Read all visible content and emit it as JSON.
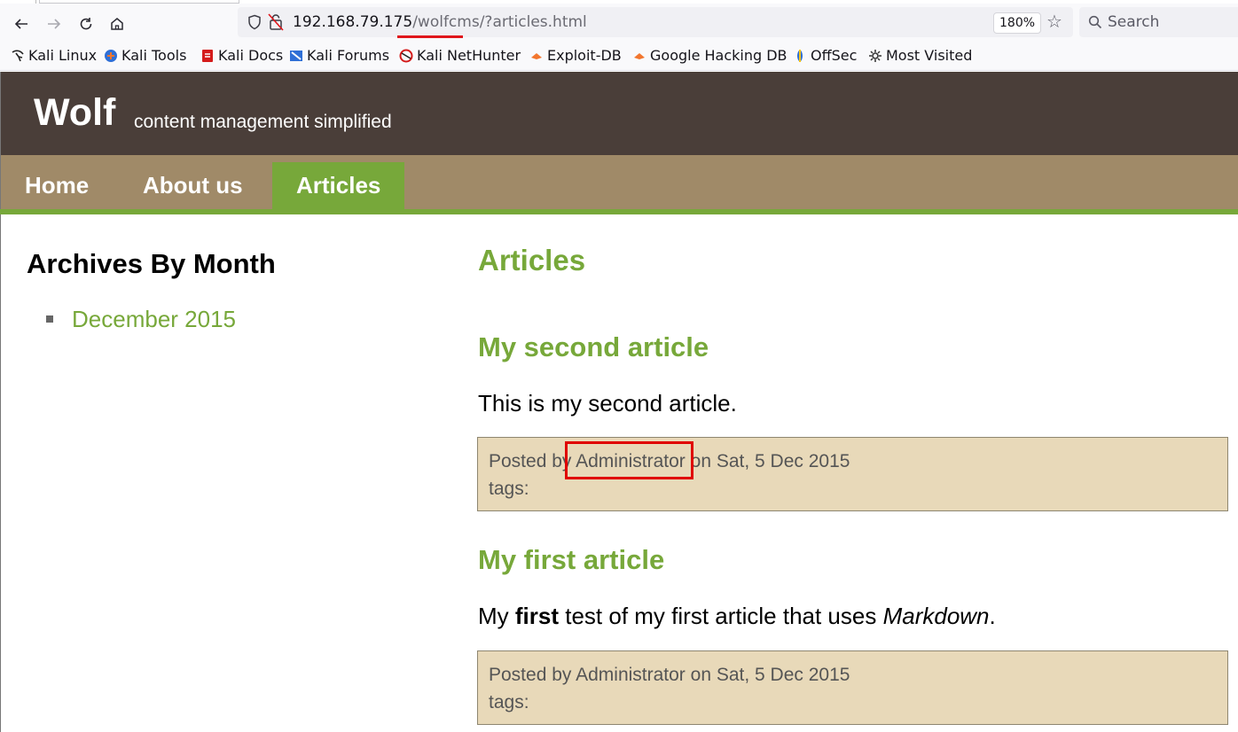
{
  "browser": {
    "url_host": "192.168.79.175",
    "url_path_highlight": "/wolfcms",
    "url_rest": "/?articles.html",
    "zoom": "180%",
    "search_placeholder": "Search"
  },
  "bookmarks": [
    {
      "label": "Kali Linux",
      "icon": "kali-dragon-icon"
    },
    {
      "label": "Kali Tools",
      "icon": "kali-tools-icon"
    },
    {
      "label": "Kali Docs",
      "icon": "kali-docs-icon"
    },
    {
      "label": "Kali Forums",
      "icon": "kali-forums-icon"
    },
    {
      "label": "Kali NetHunter",
      "icon": "nethunter-icon"
    },
    {
      "label": "Exploit-DB",
      "icon": "exploit-db-icon"
    },
    {
      "label": "Google Hacking DB",
      "icon": "ghdb-icon"
    },
    {
      "label": "OffSec",
      "icon": "offsec-icon"
    },
    {
      "label": "Most Visited",
      "icon": "gear-icon"
    }
  ],
  "site": {
    "title": "Wolf",
    "slogan": "content management simplified",
    "nav": [
      {
        "label": "Home",
        "active": false
      },
      {
        "label": "About us",
        "active": false
      },
      {
        "label": "Articles",
        "active": true
      }
    ]
  },
  "sidebar": {
    "title": "Archives By Month",
    "archives": [
      "December 2015"
    ]
  },
  "main": {
    "title": "Articles",
    "articles": [
      {
        "title": "My second article",
        "body": "This is my second article.",
        "posted_prefix": "Posted by",
        "author": "Administrator",
        "posted_suffix": "on Sat, 5 Dec 2015",
        "tags_label": "tags:"
      },
      {
        "title": "My first article",
        "body_parts": [
          "My ",
          "first",
          " test of my first article that uses ",
          "Markdown",
          "."
        ],
        "posted_prefix": "Posted by",
        "author": "Administrator",
        "posted_suffix": "on Sat, 5 Dec 2015",
        "tags_label": "tags:"
      }
    ]
  },
  "colors": {
    "header_bg": "#4a3e39",
    "nav_bg": "#a08a68",
    "accent_green": "#77a83a",
    "meta_bg": "#e8d9b9",
    "annotation_red": "#e00000"
  }
}
